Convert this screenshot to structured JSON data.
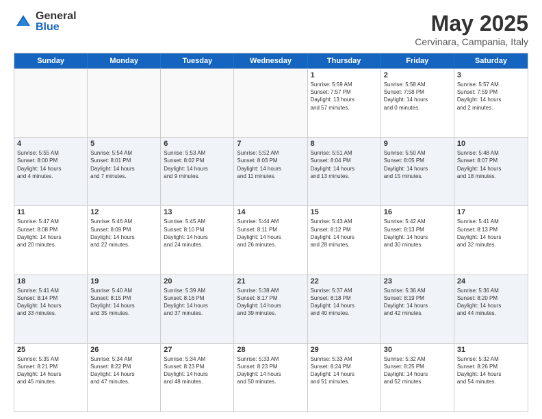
{
  "logo": {
    "general": "General",
    "blue": "Blue"
  },
  "title": "May 2025",
  "subtitle": "Cervinara, Campania, Italy",
  "days": [
    "Sunday",
    "Monday",
    "Tuesday",
    "Wednesday",
    "Thursday",
    "Friday",
    "Saturday"
  ],
  "rows": [
    [
      {
        "day": "",
        "empty": true
      },
      {
        "day": "",
        "empty": true
      },
      {
        "day": "",
        "empty": true
      },
      {
        "day": "",
        "empty": true
      },
      {
        "day": "1",
        "info": "Sunrise: 5:59 AM\nSunset: 7:57 PM\nDaylight: 13 hours\nand 57 minutes."
      },
      {
        "day": "2",
        "info": "Sunrise: 5:58 AM\nSunset: 7:58 PM\nDaylight: 14 hours\nand 0 minutes."
      },
      {
        "day": "3",
        "info": "Sunrise: 5:57 AM\nSunset: 7:59 PM\nDaylight: 14 hours\nand 2 minutes."
      }
    ],
    [
      {
        "day": "4",
        "info": "Sunrise: 5:55 AM\nSunset: 8:00 PM\nDaylight: 14 hours\nand 4 minutes."
      },
      {
        "day": "5",
        "info": "Sunrise: 5:54 AM\nSunset: 8:01 PM\nDaylight: 14 hours\nand 7 minutes."
      },
      {
        "day": "6",
        "info": "Sunrise: 5:53 AM\nSunset: 8:02 PM\nDaylight: 14 hours\nand 9 minutes."
      },
      {
        "day": "7",
        "info": "Sunrise: 5:52 AM\nSunset: 8:03 PM\nDaylight: 14 hours\nand 11 minutes."
      },
      {
        "day": "8",
        "info": "Sunrise: 5:51 AM\nSunset: 8:04 PM\nDaylight: 14 hours\nand 13 minutes."
      },
      {
        "day": "9",
        "info": "Sunrise: 5:50 AM\nSunset: 8:05 PM\nDaylight: 14 hours\nand 15 minutes."
      },
      {
        "day": "10",
        "info": "Sunrise: 5:48 AM\nSunset: 8:07 PM\nDaylight: 14 hours\nand 18 minutes."
      }
    ],
    [
      {
        "day": "11",
        "info": "Sunrise: 5:47 AM\nSunset: 8:08 PM\nDaylight: 14 hours\nand 20 minutes."
      },
      {
        "day": "12",
        "info": "Sunrise: 5:46 AM\nSunset: 8:09 PM\nDaylight: 14 hours\nand 22 minutes."
      },
      {
        "day": "13",
        "info": "Sunrise: 5:45 AM\nSunset: 8:10 PM\nDaylight: 14 hours\nand 24 minutes."
      },
      {
        "day": "14",
        "info": "Sunrise: 5:44 AM\nSunset: 8:11 PM\nDaylight: 14 hours\nand 26 minutes."
      },
      {
        "day": "15",
        "info": "Sunrise: 5:43 AM\nSunset: 8:12 PM\nDaylight: 14 hours\nand 28 minutes."
      },
      {
        "day": "16",
        "info": "Sunrise: 5:42 AM\nSunset: 8:13 PM\nDaylight: 14 hours\nand 30 minutes."
      },
      {
        "day": "17",
        "info": "Sunrise: 5:41 AM\nSunset: 8:13 PM\nDaylight: 14 hours\nand 32 minutes."
      }
    ],
    [
      {
        "day": "18",
        "info": "Sunrise: 5:41 AM\nSunset: 8:14 PM\nDaylight: 14 hours\nand 33 minutes."
      },
      {
        "day": "19",
        "info": "Sunrise: 5:40 AM\nSunset: 8:15 PM\nDaylight: 14 hours\nand 35 minutes."
      },
      {
        "day": "20",
        "info": "Sunrise: 5:39 AM\nSunset: 8:16 PM\nDaylight: 14 hours\nand 37 minutes."
      },
      {
        "day": "21",
        "info": "Sunrise: 5:38 AM\nSunset: 8:17 PM\nDaylight: 14 hours\nand 39 minutes."
      },
      {
        "day": "22",
        "info": "Sunrise: 5:37 AM\nSunset: 8:18 PM\nDaylight: 14 hours\nand 40 minutes."
      },
      {
        "day": "23",
        "info": "Sunrise: 5:36 AM\nSunset: 8:19 PM\nDaylight: 14 hours\nand 42 minutes."
      },
      {
        "day": "24",
        "info": "Sunrise: 5:36 AM\nSunset: 8:20 PM\nDaylight: 14 hours\nand 44 minutes."
      }
    ],
    [
      {
        "day": "25",
        "info": "Sunrise: 5:35 AM\nSunset: 8:21 PM\nDaylight: 14 hours\nand 45 minutes."
      },
      {
        "day": "26",
        "info": "Sunrise: 5:34 AM\nSunset: 8:22 PM\nDaylight: 14 hours\nand 47 minutes."
      },
      {
        "day": "27",
        "info": "Sunrise: 5:34 AM\nSunset: 8:23 PM\nDaylight: 14 hours\nand 48 minutes."
      },
      {
        "day": "28",
        "info": "Sunrise: 5:33 AM\nSunset: 8:23 PM\nDaylight: 14 hours\nand 50 minutes."
      },
      {
        "day": "29",
        "info": "Sunrise: 5:33 AM\nSunset: 8:24 PM\nDaylight: 14 hours\nand 51 minutes."
      },
      {
        "day": "30",
        "info": "Sunrise: 5:32 AM\nSunset: 8:25 PM\nDaylight: 14 hours\nand 52 minutes."
      },
      {
        "day": "31",
        "info": "Sunrise: 5:32 AM\nSunset: 8:26 PM\nDaylight: 14 hours\nand 54 minutes."
      }
    ]
  ]
}
